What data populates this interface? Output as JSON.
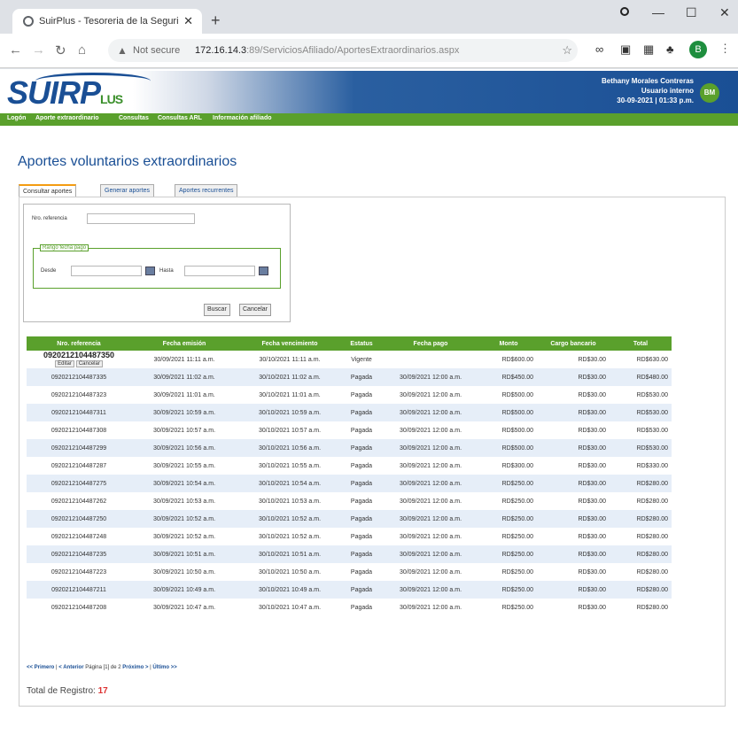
{
  "browser": {
    "tab_title": "SuirPlus - Tesoreria de la Seguri",
    "tab_close": "✕",
    "new_tab": "+",
    "url_warning": "Not secure",
    "url_host": "172.16.14.3",
    "url_path": ":89/ServiciosAfiliado/AportesExtraordinarios.aspx",
    "profile_initial": "B"
  },
  "header": {
    "logo_main": "SUIRP",
    "logo_plus": "LUS",
    "user_name": "Bethany Morales Contreras",
    "user_role": "Usuario interno",
    "user_datetime": "30-09-2021 | 01:33 p.m.",
    "avatar_initials": "BM"
  },
  "menu": {
    "items": [
      "Logón",
      "Aporte extraordinario",
      "Consultas",
      "Consultas ARL",
      "Información afiliado"
    ]
  },
  "page": {
    "title": "Aportes voluntarios extraordinarios",
    "tabs": [
      "Consultar aportes",
      "Generar aportes",
      "Aportes recurrentes"
    ]
  },
  "search": {
    "ref_label": "Nro. referencia",
    "ref_value": "",
    "range_legend": "Rango fecha pago",
    "desde_label": "Desde",
    "hasta_label": "Hasta",
    "buscar": "Buscar",
    "cancelar": "Cancelar"
  },
  "table": {
    "headers": [
      "Nro. referencia",
      "Fecha emisión",
      "Fecha vencimiento",
      "Estatus",
      "Fecha pago",
      "Monto",
      "Cargo bancario",
      "Total"
    ],
    "first_row_actions": [
      "Editar",
      "Cancelar"
    ],
    "rows": [
      [
        "0920212104487350",
        "30/09/2021 11:11 a.m.",
        "30/10/2021 11:11 a.m.",
        "Vigente",
        "",
        "RD$600.00",
        "RD$30.00",
        "RD$630.00"
      ],
      [
        "0920212104487335",
        "30/09/2021 11:02 a.m.",
        "30/10/2021 11:02 a.m.",
        "Pagada",
        "30/09/2021 12:00 a.m.",
        "RD$450.00",
        "RD$30.00",
        "RD$480.00"
      ],
      [
        "0920212104487323",
        "30/09/2021 11:01 a.m.",
        "30/10/2021 11:01 a.m.",
        "Pagada",
        "30/09/2021 12:00 a.m.",
        "RD$500.00",
        "RD$30.00",
        "RD$530.00"
      ],
      [
        "0920212104487311",
        "30/09/2021 10:59 a.m.",
        "30/10/2021 10:59 a.m.",
        "Pagada",
        "30/09/2021 12:00 a.m.",
        "RD$500.00",
        "RD$30.00",
        "RD$530.00"
      ],
      [
        "0920212104487308",
        "30/09/2021 10:57 a.m.",
        "30/10/2021 10:57 a.m.",
        "Pagada",
        "30/09/2021 12:00 a.m.",
        "RD$500.00",
        "RD$30.00",
        "RD$530.00"
      ],
      [
        "0920212104487299",
        "30/09/2021 10:56 a.m.",
        "30/10/2021 10:56 a.m.",
        "Pagada",
        "30/09/2021 12:00 a.m.",
        "RD$500.00",
        "RD$30.00",
        "RD$530.00"
      ],
      [
        "0920212104487287",
        "30/09/2021 10:55 a.m.",
        "30/10/2021 10:55 a.m.",
        "Pagada",
        "30/09/2021 12:00 a.m.",
        "RD$300.00",
        "RD$30.00",
        "RD$330.00"
      ],
      [
        "0920212104487275",
        "30/09/2021 10:54 a.m.",
        "30/10/2021 10:54 a.m.",
        "Pagada",
        "30/09/2021 12:00 a.m.",
        "RD$250.00",
        "RD$30.00",
        "RD$280.00"
      ],
      [
        "0920212104487262",
        "30/09/2021 10:53 a.m.",
        "30/10/2021 10:53 a.m.",
        "Pagada",
        "30/09/2021 12:00 a.m.",
        "RD$250.00",
        "RD$30.00",
        "RD$280.00"
      ],
      [
        "0920212104487250",
        "30/09/2021 10:52 a.m.",
        "30/10/2021 10:52 a.m.",
        "Pagada",
        "30/09/2021 12:00 a.m.",
        "RD$250.00",
        "RD$30.00",
        "RD$280.00"
      ],
      [
        "0920212104487248",
        "30/09/2021 10:52 a.m.",
        "30/10/2021 10:52 a.m.",
        "Pagada",
        "30/09/2021 12:00 a.m.",
        "RD$250.00",
        "RD$30.00",
        "RD$280.00"
      ],
      [
        "0920212104487235",
        "30/09/2021 10:51 a.m.",
        "30/10/2021 10:51 a.m.",
        "Pagada",
        "30/09/2021 12:00 a.m.",
        "RD$250.00",
        "RD$30.00",
        "RD$280.00"
      ],
      [
        "0920212104487223",
        "30/09/2021 10:50 a.m.",
        "30/10/2021 10:50 a.m.",
        "Pagada",
        "30/09/2021 12:00 a.m.",
        "RD$250.00",
        "RD$30.00",
        "RD$280.00"
      ],
      [
        "0920212104487211",
        "30/09/2021 10:49 a.m.",
        "30/10/2021 10:49 a.m.",
        "Pagada",
        "30/09/2021 12:00 a.m.",
        "RD$250.00",
        "RD$30.00",
        "RD$280.00"
      ],
      [
        "0920212104487208",
        "30/09/2021 10:47 a.m.",
        "30/10/2021 10:47 a.m.",
        "Pagada",
        "30/09/2021 12:00 a.m.",
        "RD$250.00",
        "RD$30.00",
        "RD$280.00"
      ]
    ]
  },
  "pager": {
    "first": "<< Primero",
    "prev": "< Anterior",
    "info": "Página [1] de 2",
    "next": "Próximo >",
    "last": "Último >>"
  },
  "footer": {
    "total_label": "Total de Registro:",
    "total_count": "17"
  }
}
